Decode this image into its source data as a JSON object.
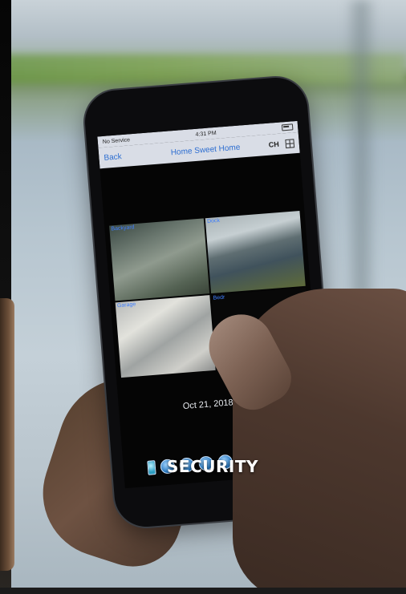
{
  "phone": {
    "status": {
      "carrier": "No Service",
      "time": "4:31 PM"
    },
    "nav": {
      "back": "Back",
      "title": "Home Sweet Home",
      "ch": "CH"
    },
    "cameras": [
      {
        "label": "Backyard"
      },
      {
        "label": "Dock"
      },
      {
        "label": "Garage"
      },
      {
        "label": "Bedr"
      }
    ],
    "date": "Oct 21, 2018, 4:31"
  },
  "caption": "SECURITY",
  "colors": {
    "accent": "#2f6fd1"
  }
}
